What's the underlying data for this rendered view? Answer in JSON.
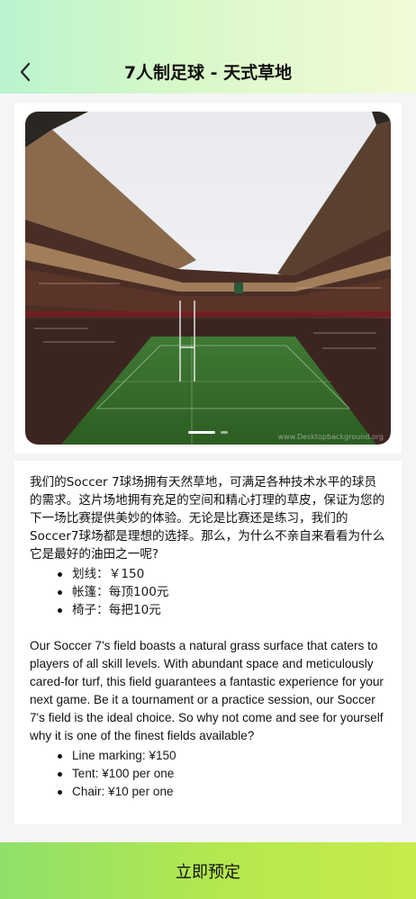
{
  "header": {
    "title": "7人制足球 - 天式草地"
  },
  "gallery": {
    "watermark": "www.Desktopbackground.org",
    "slide_index": 1,
    "slide_count": 2
  },
  "description": {
    "cn_paragraph": "我们的Soccer 7球场拥有天然草地，可满足各种技术水平的球员的需求。这片场地拥有充足的空间和精心打理的草皮，保证为您的下一场比赛提供美妙的体验。无论是比赛还是练习，我们的Soccer7球场都是理想的选择。那么，为什么不亲自来看看为什么它是最好的油田之一呢?",
    "cn_items": [
      "划线：￥150",
      "帐篷：每顶100元",
      "椅子：每把10元"
    ],
    "en_paragraph": "Our Soccer 7's field boasts a natural grass surface that caters to players of all skill levels. With abundant space and meticulously cared-for turf, this field guarantees a fantastic experience for your next game. Be it a tournament or a practice session, our Soccer 7's field is the ideal choice. So why not come and see for yourself why it is one of the finest fields available?",
    "en_items": [
      "Line marking: ¥150",
      "Tent: ¥100 per one",
      "Chair: ¥10 per one"
    ]
  },
  "footer": {
    "book_label": "立即预定"
  },
  "colors": {
    "header_gradient": [
      "#b9f4cf",
      "#f2fbd9"
    ],
    "button_gradient": [
      "#8fe06a",
      "#c5ec4a"
    ]
  }
}
